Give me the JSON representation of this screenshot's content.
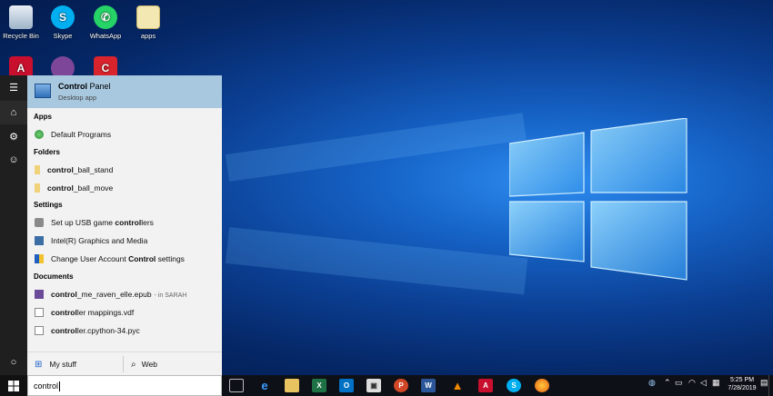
{
  "desktop": {
    "icons": [
      {
        "label": "Recycle Bin"
      },
      {
        "label": "Skype"
      },
      {
        "label": "WhatsApp"
      },
      {
        "label": "apps"
      }
    ]
  },
  "start_menu": {
    "best_match": {
      "title_bold": "Control",
      "title_rest": " Panel",
      "subtitle": "Desktop app"
    },
    "groups": {
      "apps": {
        "heading": "Apps",
        "items": [
          {
            "pre": "",
            "bold": "",
            "post": "Default Programs"
          }
        ]
      },
      "folders": {
        "heading": "Folders",
        "items": [
          {
            "pre": "",
            "bold": "control",
            "post": "_ball_stand"
          },
          {
            "pre": "",
            "bold": "control",
            "post": "_ball_move"
          }
        ]
      },
      "settings": {
        "heading": "Settings",
        "items": [
          {
            "pre": "Set up USB game ",
            "bold": "control",
            "post": "lers"
          },
          {
            "pre": "Intel(R) Graphics and Media",
            "bold": "",
            "post": ""
          },
          {
            "pre": "Change User Account ",
            "bold": "Control",
            "post": " settings"
          }
        ]
      },
      "documents": {
        "heading": "Documents",
        "items": [
          {
            "pre": "",
            "bold": "control",
            "post": "_me_raven_elle.epub",
            "location": "- in SARAH"
          },
          {
            "pre": "",
            "bold": "control",
            "post": "ler mappings.vdf"
          },
          {
            "pre": "",
            "bold": "control",
            "post": "ler.cpython-34.pyc"
          }
        ]
      }
    },
    "tabs": {
      "my_stuff": "My stuff",
      "web": "Web"
    },
    "search_value": "control"
  },
  "taskbar": {
    "clock_time": "5:25 PM",
    "clock_date": "7/28/2019"
  },
  "colors": {
    "selection": "#a8c8e0",
    "taskbar": "#0e1018",
    "rail": "#1f1f1f"
  }
}
